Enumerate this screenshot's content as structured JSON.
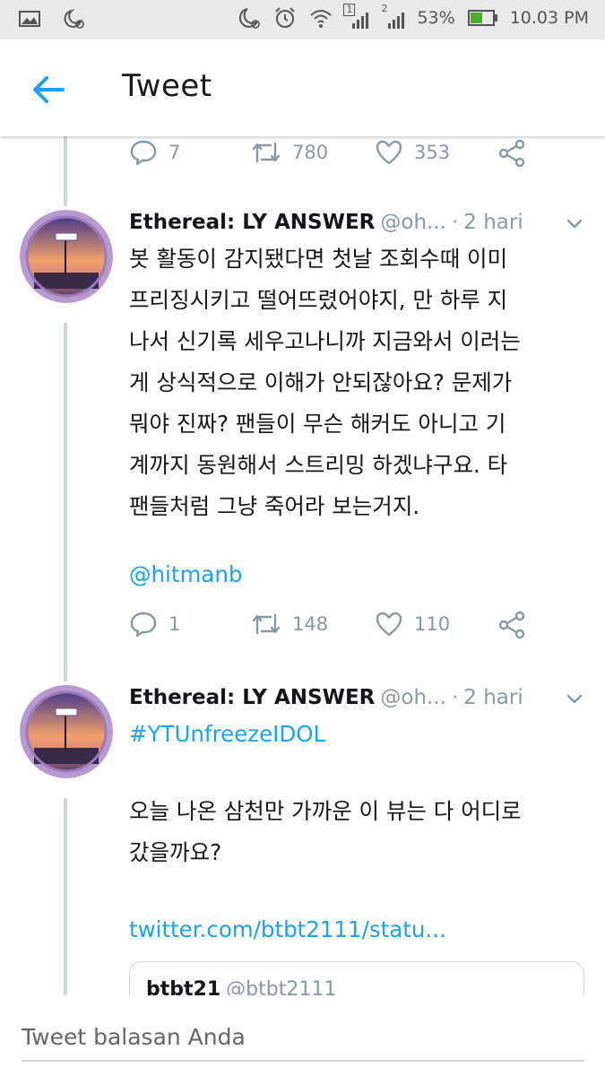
{
  "status_bar": {
    "sim1": "1",
    "sim2": "2",
    "battery_percent": "53%",
    "battery_level": 0.53,
    "time": "10.03 PM",
    "icons": [
      "gallery-icon",
      "alarm-snooze-icon",
      "do-not-disturb-icon",
      "alarm-icon",
      "wifi-icon",
      "signal-icon",
      "battery-icon"
    ]
  },
  "header": {
    "title": "Tweet",
    "back_icon": "arrow-left-icon"
  },
  "colors": {
    "accent": "#1da1f2",
    "muted": "#8899a6",
    "thread_line": "#ccd6dd"
  },
  "prev_actions": {
    "reply_count": "7",
    "retweet_count": "780",
    "like_count": "353"
  },
  "tweets": [
    {
      "name": "Ethereal: LY ANSWER",
      "handle": "@oh...",
      "time": "2 hari",
      "lines": [
        "봇 활동이 감지됐다면 첫날 조회수때 이미",
        "프리징시키고 떨어뜨렸어야지, 만 하루 지",
        "나서 신기록 세우고나니까 지금와서 이러는",
        "게 상식적으로 이해가 안되잖아요? 문제가",
        "뭐야 진짜? 팬들이 무슨 해커도 아니고 기",
        "계까지 동원해서 스트리밍 하겠냐구요. 타",
        "팬들처럼 그냥 죽어라 보는거지."
      ],
      "mention": "@hitmanb",
      "reply_count": "1",
      "retweet_count": "148",
      "like_count": "110"
    },
    {
      "name": "Ethereal: LY ANSWER",
      "handle": "@oh...",
      "time": "2 hari",
      "hashtag": "#YTUnfreezeIDOL",
      "lines": [
        "오늘 나온 삼천만 가까운 이 뷰는 다 어디로",
        "갔을까요?"
      ],
      "link": "twitter.com/btbt2111/statu...",
      "quoted": {
        "name": "btbt21",
        "handle": "@btbt2111"
      }
    }
  ],
  "reply": {
    "placeholder": "Tweet balasan Anda"
  }
}
